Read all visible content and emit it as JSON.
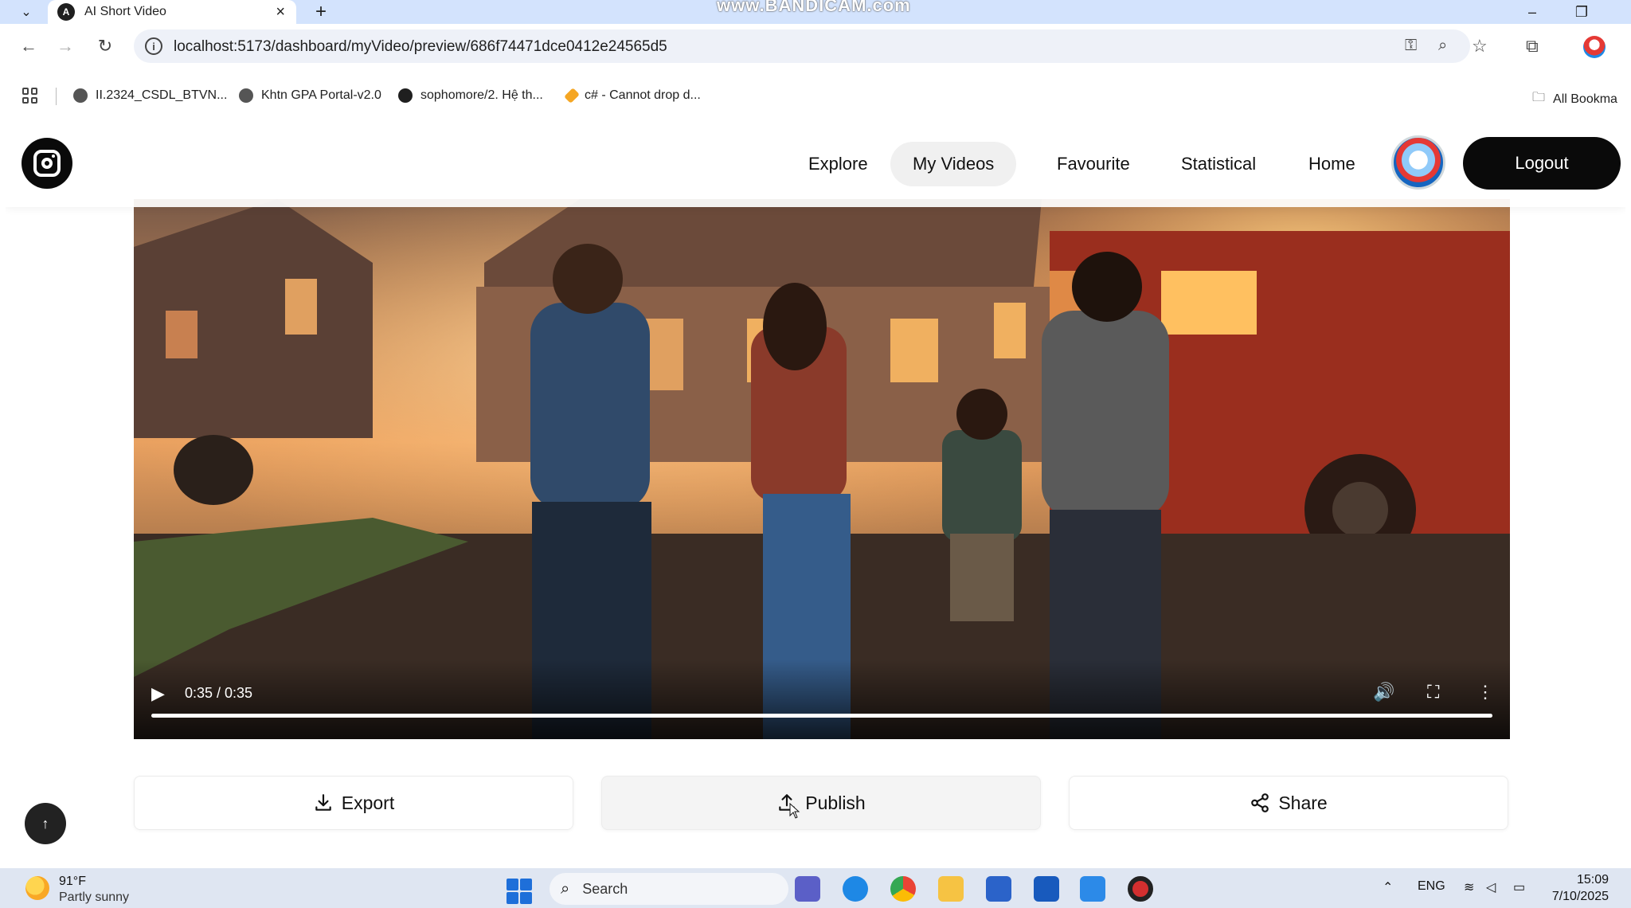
{
  "browser": {
    "tab_title": "AI Short Video",
    "new_tab_symbol": "+",
    "tab_close_symbol": "×",
    "watermark": "www.BANDICAM.com",
    "url": "localhost:5173/dashboard/myVideo/preview/686f74471dce0412e24565d5",
    "bookmarks": [
      {
        "label": "II.2324_CSDL_BTVN..."
      },
      {
        "label": "Khtn GPA Portal-v2.0"
      },
      {
        "label": "sophomore/2. Hệ th..."
      },
      {
        "label": "c# - Cannot drop d..."
      }
    ],
    "all_bookmarks": "All Bookma"
  },
  "app": {
    "nav": {
      "explore": "Explore",
      "my_videos": "My Videos",
      "favourite": "Favourite",
      "statistical": "Statistical",
      "home": "Home",
      "logout": "Logout"
    },
    "video": {
      "time": "0:35 / 0:35",
      "progress": 1.0
    },
    "actions": {
      "export": "Export",
      "publish": "Publish",
      "share": "Share"
    },
    "scroll_top_symbol": "↑"
  },
  "taskbar": {
    "weather_temp": "91°F",
    "weather_desc": "Partly sunny",
    "search_label": "Search",
    "lang": "ENG",
    "time": "15:09",
    "date": "7/10/2025"
  },
  "colors": {
    "tab_strip": "#d3e3fd",
    "accent_dark": "#0a0a0a",
    "taskbar": "#dfe6f2"
  }
}
